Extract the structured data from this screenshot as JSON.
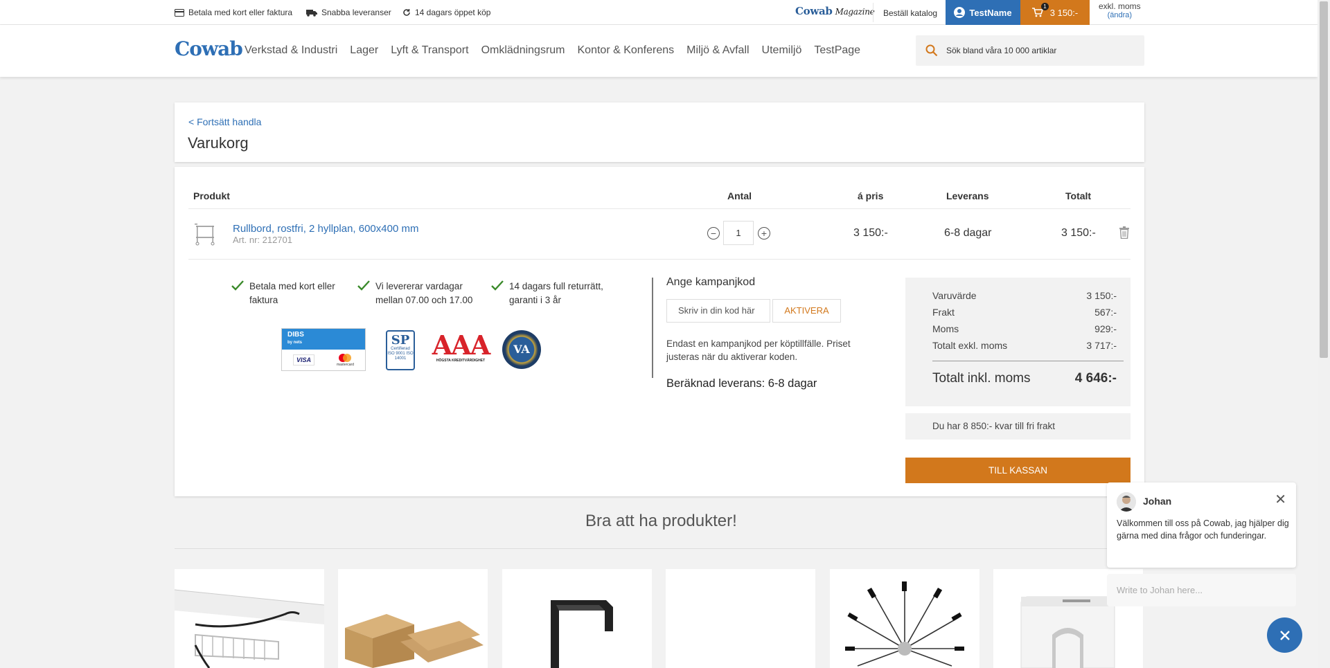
{
  "topbar": {
    "usps": [
      "Betala med kort eller faktura",
      "Snabba leveranser",
      "14 dagars öppet köp"
    ],
    "magazine_brand": "Cowab",
    "magazine_script": "Magazine",
    "catalog_link": "Beställ katalog",
    "user_name": "TestName",
    "cart_count": "1",
    "cart_total": "3 150:-",
    "vat_mode": "exkl. moms",
    "vat_change": "(ändra)"
  },
  "header": {
    "logo": "Cowab",
    "nav": [
      "Verkstad & Industri",
      "Lager",
      "Lyft & Transport",
      "Omklädningsrum",
      "Kontor & Konferens",
      "Miljö & Avfall",
      "Utemiljö",
      "TestPage"
    ],
    "search_placeholder": "Sök bland våra 10 000 artiklar"
  },
  "page": {
    "back_link": "< Fortsätt handla",
    "title": "Varukorg"
  },
  "cart_table": {
    "headers": [
      "Produkt",
      "Antal",
      "á pris",
      "Leverans",
      "Totalt"
    ],
    "rows": [
      {
        "name": "Rullbord, rostfri, 2 hyllplan, 600x400 mm",
        "art": "Art. nr: 212701",
        "qty": "1",
        "price": "3 150:-",
        "delivery": "6-8 dagar",
        "total": "3 150:-"
      }
    ]
  },
  "features": [
    "Betala med kort eller faktura",
    "Vi levererar vardagar mellan 07.00 och 17.00",
    "14 dagars full returrätt, garanti i 3 år"
  ],
  "trust": {
    "dibs_top": "DIBS",
    "dibs_sub": "by nets",
    "visa": "VISA",
    "mastercard": "mastercard",
    "sp": "SP",
    "sp_sub": "Certifierad ISO 9001 ISO 14001",
    "aaa": "AAA",
    "aaa_sub": "HÖGSTA KREDITVÄRDIGHET",
    "va": "VA"
  },
  "campaign": {
    "title": "Ange kampanjkod",
    "placeholder": "Skriv in din kod här",
    "button": "AKTIVERA",
    "note": "Endast en kampanjkod per köptillfälle. Priset justeras när du aktiverar koden.",
    "delivery_estimate": "Beräknad leverans: 6-8 dagar"
  },
  "summary": {
    "rows": [
      {
        "label": "Varuvärde",
        "value": "3 150:-"
      },
      {
        "label": "Frakt",
        "value": "567:-"
      },
      {
        "label": "Moms",
        "value": "929:-"
      },
      {
        "label": "Totalt exkl. moms",
        "value": "3 717:-"
      }
    ],
    "total_label": "Totalt inkl. moms",
    "total_value": "4 646:-",
    "free_shipping": "Du har 8 850:- kvar till fri frakt",
    "checkout": "TILL KASSAN"
  },
  "recommend": {
    "title": "Bra att ha produkter!"
  },
  "chat": {
    "agent": "Johan",
    "message": "Välkommen till oss på Cowab, jag hjälper dig gärna med dina frågor och funderingar.",
    "input_placeholder": "Write to Johan here..."
  },
  "colors": {
    "accent_blue": "#2e6fb5",
    "accent_orange": "#d2781c",
    "check_green": "#3a8a2a"
  }
}
